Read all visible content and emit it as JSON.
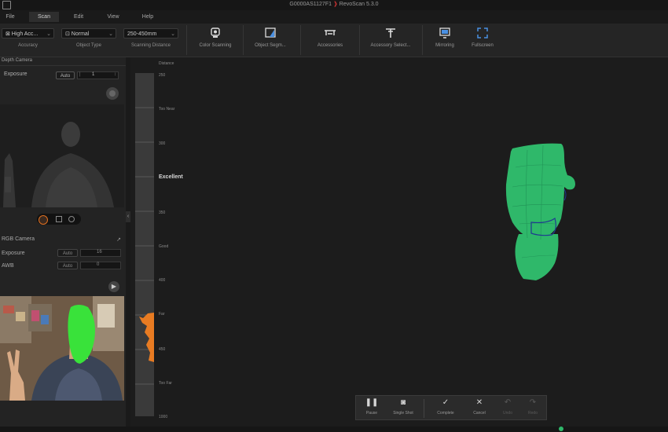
{
  "titlebar": {
    "title": "G0000AS1127F1",
    "app": "RevoScan 5.3.0"
  },
  "menu": [
    {
      "label": "File",
      "active": false
    },
    {
      "label": "Scan",
      "active": true
    },
    {
      "label": "Edit",
      "active": false
    },
    {
      "label": "View",
      "active": false
    },
    {
      "label": "Help",
      "active": false
    }
  ],
  "toolbar": {
    "accuracy": {
      "value": "⊠ High Acc...",
      "caption": "Accuracy"
    },
    "object_type": {
      "value": "⊡ Normal",
      "caption": "Object Type"
    },
    "scanning_distance": {
      "value": "250-450mm",
      "caption": "Scanning Distance"
    },
    "tools": [
      {
        "label": "Color Scanning",
        "icon": "color-scan-icon"
      },
      {
        "label": "Object Segm...",
        "icon": "object-segmentation-icon"
      },
      {
        "label": "Accessories",
        "icon": "accessories-icon"
      },
      {
        "label": "Accessory Select...",
        "icon": "accessory-select-icon"
      },
      {
        "label": "Mirroring",
        "icon": "mirroring-icon"
      },
      {
        "label": "Fullscreen",
        "icon": "fullscreen-icon"
      }
    ]
  },
  "depth_camera": {
    "header": "Depth Camera",
    "exposure_label": "Exposure",
    "exposure_mode": "Auto",
    "exposure_value": "1"
  },
  "rgb_camera": {
    "header": "RGB Camera",
    "exposure_label": "Exposure",
    "exposure_mode": "Auto",
    "exposure_value": "16",
    "awb_label": "AWB",
    "awb_mode": "Auto",
    "awb_value": "0"
  },
  "ruler": {
    "title": "Distance",
    "labels": [
      "250",
      "Too Near",
      "300",
      "Excellent",
      "350",
      "Good",
      "400",
      "Far",
      "450",
      "Too Far",
      "1000"
    ]
  },
  "scan_controls": [
    {
      "label": "Pause",
      "glyph": "❚❚",
      "icon": "pause-icon",
      "enabled": true
    },
    {
      "label": "Single Shot",
      "glyph": "◙",
      "icon": "camera-icon",
      "enabled": true
    },
    {
      "label": "Complete",
      "glyph": "✓",
      "icon": "check-icon",
      "enabled": true
    },
    {
      "label": "Cancel",
      "glyph": "✕",
      "icon": "close-icon",
      "enabled": true
    },
    {
      "label": "Undo",
      "glyph": "↶",
      "icon": "undo-icon",
      "enabled": false
    },
    {
      "label": "Redo",
      "glyph": "↷",
      "icon": "redo-icon",
      "enabled": false
    }
  ],
  "colors": {
    "mesh": "#2fb86a",
    "mask": "#39e23a",
    "ruler_marker": "#e87b22"
  }
}
